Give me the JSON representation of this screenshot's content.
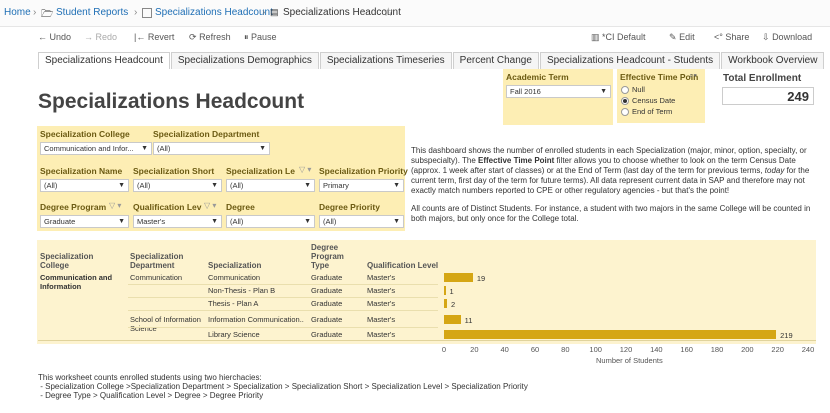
{
  "breadcrumb": {
    "home": "Home",
    "item1": "Student Reports",
    "item2": "Specializations Headcount",
    "item3": "Specializations Headcount"
  },
  "toolbar": {
    "undo": "Undo",
    "redo": "Redo",
    "revert": "Revert",
    "refresh": "Refresh",
    "pause": "Pause",
    "view": "*CI Default",
    "edit": "Edit",
    "share": "Share",
    "download": "Download"
  },
  "tabs": [
    "Specializations Headcount",
    "Specializations Demographics",
    "Specializations Timeseries",
    "Percent Change",
    "Specializations Headcount - Students",
    "Workbook Overview"
  ],
  "title": "Specializations Headcount",
  "academic_term": {
    "label": "Academic Term",
    "value": "Fall 2016"
  },
  "effective_time": {
    "label": "Effective Time Poin",
    "options": [
      "Null",
      "Census Date",
      "End of Term"
    ],
    "selected": "Census Date"
  },
  "total_enrollment": {
    "label": "Total Enrollment",
    "value": "249"
  },
  "filters": {
    "college": {
      "label": "Specialization College",
      "value": "Communication and Infor..."
    },
    "department": {
      "label": "Specialization Department",
      "value": "(All)"
    },
    "name": {
      "label": "Specialization Name",
      "value": "(All)"
    },
    "short": {
      "label": "Specialization Short",
      "value": "(All)"
    },
    "level": {
      "label": "Specialization Le",
      "value": "(All)"
    },
    "priority": {
      "label": "Specialization Priority",
      "value": "Primary"
    },
    "degree_program": {
      "label": "Degree Program",
      "value": "Graduate"
    },
    "qual_level": {
      "label": "Qualification Lev",
      "value": "Master's"
    },
    "degree": {
      "label": "Degree",
      "value": "(All)"
    },
    "degree_priority": {
      "label": "Degree Priority",
      "value": "(All)"
    }
  },
  "description": {
    "p1_a": "This dashboard shows the number of enrolled students in each Specialization (major, minor, option, specialty, or subspecialty). The ",
    "p1_bold": "Effective Time Point",
    "p1_b": " filter allows you to choose whether to look on the term Census Date (approx. 1 week after start of classes) or at the End of Term (last day of the term for previous terms, ",
    "p1_italic": "today",
    "p1_c": " for the current term, first day of the term for future terms). All data represent current data in SAP and therefore may not exactly match numbers reported to CPE or other regulatory agencies - but that's the point!",
    "p2": "All counts are of Distinct Students. For instance, a student with two majors in the same College will be counted in both majors, but only once for the College total."
  },
  "table": {
    "headers": {
      "college": "Specialization College",
      "department": "Specialization Department",
      "specialization": "Specialization",
      "program": "Degree Program Type",
      "qual": "Qualification Level"
    },
    "college": "Communication and Information",
    "rows": [
      {
        "department": "Communication",
        "specialization": "Communication",
        "program": "Graduate",
        "qual": "Master's",
        "value": 19,
        "label": "19"
      },
      {
        "department": "",
        "specialization": "Non-Thesis - Plan B",
        "program": "Graduate",
        "qual": "Master's",
        "value": 1,
        "label": "1"
      },
      {
        "department": "",
        "specialization": "Thesis - Plan A",
        "program": "Graduate",
        "qual": "Master's",
        "value": 2,
        "label": "2"
      },
      {
        "department": "School of Information Science",
        "specialization": "Information Communication..",
        "program": "Graduate",
        "qual": "Master's",
        "value": 11,
        "label": "11"
      },
      {
        "department": "",
        "specialization": "Library Science",
        "program": "Graduate",
        "qual": "Master's",
        "value": 219,
        "label": "219"
      }
    ],
    "axis_ticks": [
      "0",
      "20",
      "40",
      "60",
      "80",
      "100",
      "120",
      "140",
      "160",
      "180",
      "200",
      "220",
      "240"
    ],
    "axis_label": "Number of Students"
  },
  "chart_data": {
    "type": "bar",
    "categories": [
      "Communication",
      "Non-Thesis - Plan B",
      "Thesis - Plan A",
      "Information Communication..",
      "Library Science"
    ],
    "values": [
      19,
      1,
      2,
      11,
      219
    ],
    "xlabel": "Number of Students",
    "xlim": [
      0,
      240
    ]
  },
  "footer": {
    "line1": "This worksheet counts enrolled students using two hierchacies:",
    "line2": " - Specialization College >Specialization Department > Specialization > Specialization Short > Specialization Level > Specialization Priority",
    "line3": " - Degree Type > Qualification Level > Degree > Degree Priority"
  },
  "colors": {
    "bar": "#d5a614",
    "filter_bg": "#fdeeb4",
    "link": "#1f6fb5"
  }
}
